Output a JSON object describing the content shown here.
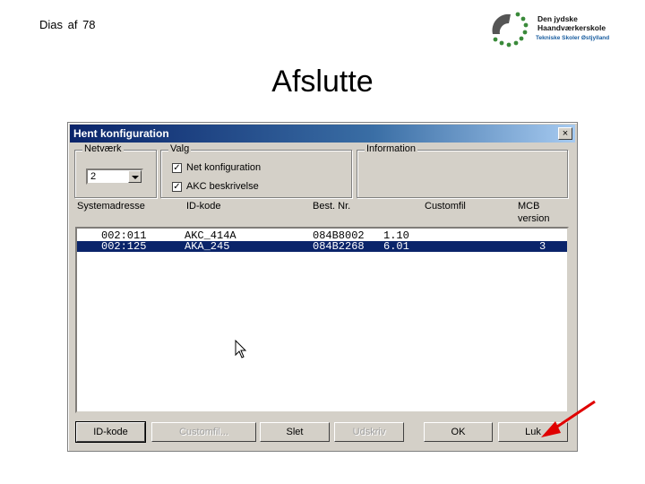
{
  "slide": {
    "counter": "Dias af 78",
    "title": "Afslutte",
    "logo": {
      "name": "Den jydske Haandværkerskole",
      "subtitle": "Tekniske Skoler Østjylland"
    }
  },
  "dialog": {
    "title": "Hent konfiguration",
    "close_glyph": "×",
    "groups": {
      "netvaerk": {
        "label": "Netværk",
        "combo_value": "2"
      },
      "valg": {
        "label": "Valg",
        "options": [
          {
            "label": "Net konfiguration",
            "checked": true
          },
          {
            "label": "AKC beskrivelse",
            "checked": true
          }
        ]
      },
      "information": {
        "label": "Information"
      }
    },
    "columns": [
      "Systemadresse",
      "ID-kode",
      "Best. Nr.",
      "Customfil",
      "MCB version"
    ],
    "rows": [
      {
        "address": "002:011",
        "id_code": "AKC_414A",
        "best_nr": "084B8002",
        "version_a": "1.10",
        "mcb": "",
        "selected": false
      },
      {
        "address": "002:125",
        "id_code": "AKA_245",
        "best_nr": "084B2268",
        "version_a": "6.01",
        "mcb": "3",
        "selected": true
      }
    ],
    "buttons": {
      "id_kode": "ID-kode",
      "customfil": "Customfil...",
      "slet": "Slet",
      "udskriv": "Udskriv",
      "ok": "OK",
      "luk": "Luk"
    }
  },
  "colors": {
    "selection": "#0a246a",
    "arrow": "#e00000",
    "dialog_bg": "#d4d0c8"
  }
}
